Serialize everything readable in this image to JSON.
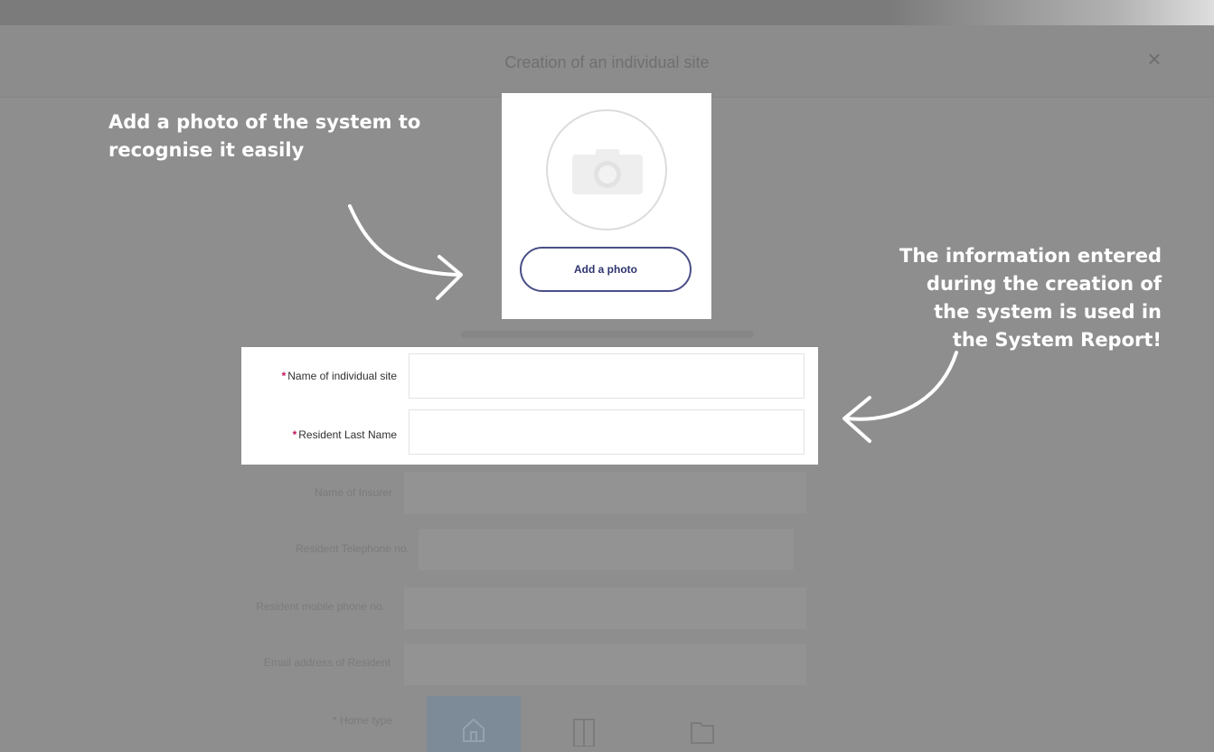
{
  "status_bar": {
    "left": "",
    "right": ""
  },
  "app_bar": {
    "title": "Creation of an individual site",
    "close_label": "×"
  },
  "photo": {
    "add_photo_label": "Add a photo"
  },
  "form": {
    "fields": [
      {
        "label": "Name of individual site",
        "required": "*",
        "value": ""
      },
      {
        "label": "Resident Last Name",
        "required": "*",
        "value": ""
      }
    ],
    "background_fields": [
      {
        "label": "Name of Insurer"
      },
      {
        "label": "Resident Telephone no."
      },
      {
        "label": "Resident mobile phone no."
      },
      {
        "label": "Email address of Resident"
      },
      {
        "label": "* Home type"
      }
    ]
  },
  "annotations": {
    "left": "Add a photo of the system to recognise it easily",
    "right": "The information entered during the creation of the system is used in the System Report!"
  }
}
